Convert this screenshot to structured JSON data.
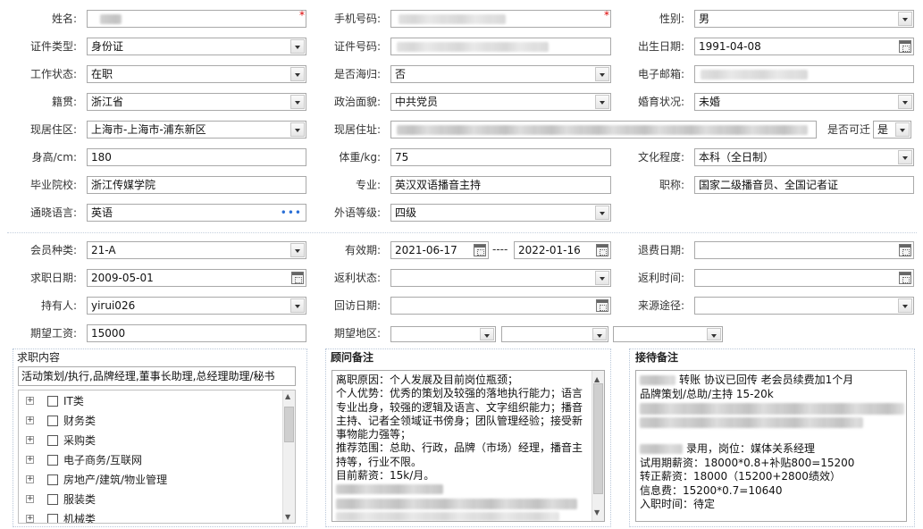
{
  "basic": {
    "name_label": "姓名:",
    "phone_label": "手机号码:",
    "gender_label": "性别:",
    "gender_value": "男",
    "id_type_label": "证件类型:",
    "id_type_value": "身份证",
    "id_no_label": "证件号码:",
    "birth_label": "出生日期:",
    "birth_value": "1991-04-08",
    "work_status_label": "工作状态:",
    "work_status_value": "在职",
    "returnee_label": "是否海归:",
    "returnee_value": "否",
    "email_label": "电子邮箱:",
    "native_label": "籍贯:",
    "native_value": "浙江省",
    "political_label": "政治面貌:",
    "political_value": "中共党员",
    "marital_label": "婚育状况:",
    "marital_value": "未婚",
    "area_label": "现居住区:",
    "area_value": "上海市-上海市-浦东新区",
    "address_label": "现居住址:",
    "relocate_label": "是否可迁",
    "relocate_value": "是",
    "height_label": "身高/cm:",
    "height_value": "180",
    "weight_label": "体重/kg:",
    "weight_value": "75",
    "edu_label": "文化程度:",
    "edu_value": "本科（全日制）",
    "school_label": "毕业院校:",
    "school_value": "浙江传媒学院",
    "major_label": "专业:",
    "major_value": "英汉双语播音主持",
    "title_label": "职称:",
    "title_value": "国家二级播音员、全国记者证",
    "language_label": "通晓语言:",
    "language_value": "英语",
    "language_more": "•••",
    "lang_level_label": "外语等级:",
    "lang_level_value": "四级",
    "required_mark": "*"
  },
  "membership": {
    "type_label": "会员种类:",
    "type_value": "21-A",
    "valid_label": "有效期:",
    "valid_from": "2021-06-17",
    "valid_sep": "----",
    "valid_to": "2022-01-16",
    "refund_label": "退费日期:",
    "jobseek_date_label": "求职日期:",
    "jobseek_date_value": "2009-05-01",
    "rebate_status_label": "返利状态:",
    "rebate_time_label": "返利时间:",
    "holder_label": "持有人:",
    "holder_value": "yirui026",
    "visit_date_label": "回访日期:",
    "source_label": "来源途径:",
    "salary_label": "期望工资:",
    "salary_value": "15000",
    "region_label": "期望地区:"
  },
  "job_content": {
    "title": "求职内容",
    "summary": "活动策划/执行,品牌经理,董事长助理,总经理助理/秘书",
    "categories": [
      "IT类",
      "财务类",
      "采购类",
      "电子商务/互联网",
      "房地产/建筑/物业管理",
      "服装类",
      "机械类"
    ]
  },
  "advisor_notes": {
    "title": "顾问备注",
    "lines": [
      "离职原因：个人发展及目前岗位瓶颈；",
      "个人优势：优秀的策划及较强的落地执行能力；语言",
      "专业出身，较强的逻辑及语言、文字组织能力；播音",
      "主持、记者全领域证书傍身；团队管理经验；接受新",
      "事物能力强等；",
      "推荐范围：总助、行政，品牌（市场）经理，播音主",
      "持等，行业不限。",
      "目前薪资：15k/月。"
    ]
  },
  "reception_notes": {
    "title": "接待备注",
    "line1": "转账 协议已回传 老会员续费加1个月",
    "line2": "品牌策划/总助/主持  15-20k",
    "line3": "录用，岗位：媒体关系经理",
    "line4": "试用期薪资：18000*0.8+补贴800=15200",
    "line5": "转正薪资：18000（15200+2800绩效）",
    "line6": "信息费：15200*0.7=10640",
    "line7": "入职时间：待定"
  }
}
